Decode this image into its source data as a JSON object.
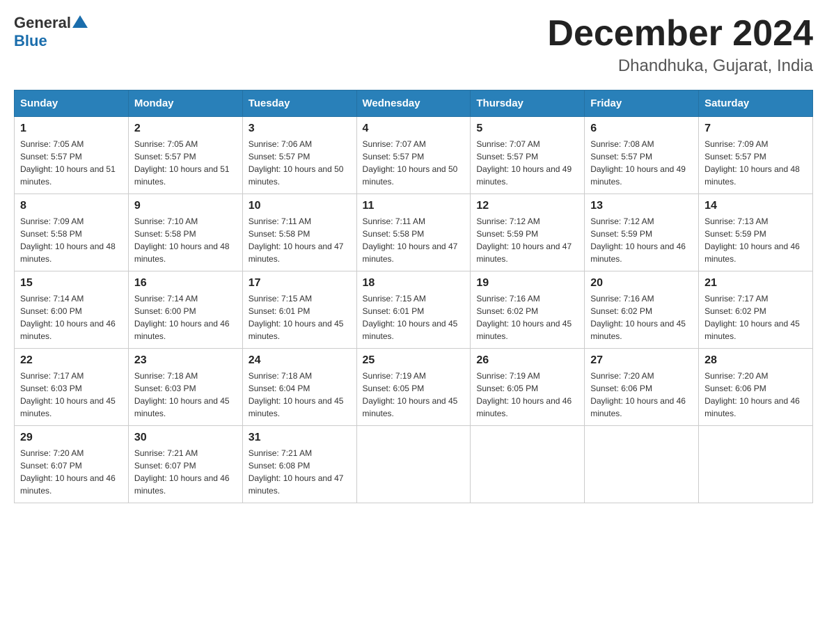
{
  "header": {
    "logo_general": "General",
    "logo_blue": "Blue",
    "month_title": "December 2024",
    "location": "Dhandhuka, Gujarat, India"
  },
  "weekdays": [
    "Sunday",
    "Monday",
    "Tuesday",
    "Wednesday",
    "Thursday",
    "Friday",
    "Saturday"
  ],
  "weeks": [
    [
      {
        "day": "1",
        "sunrise": "7:05 AM",
        "sunset": "5:57 PM",
        "daylight": "10 hours and 51 minutes."
      },
      {
        "day": "2",
        "sunrise": "7:05 AM",
        "sunset": "5:57 PM",
        "daylight": "10 hours and 51 minutes."
      },
      {
        "day": "3",
        "sunrise": "7:06 AM",
        "sunset": "5:57 PM",
        "daylight": "10 hours and 50 minutes."
      },
      {
        "day": "4",
        "sunrise": "7:07 AM",
        "sunset": "5:57 PM",
        "daylight": "10 hours and 50 minutes."
      },
      {
        "day": "5",
        "sunrise": "7:07 AM",
        "sunset": "5:57 PM",
        "daylight": "10 hours and 49 minutes."
      },
      {
        "day": "6",
        "sunrise": "7:08 AM",
        "sunset": "5:57 PM",
        "daylight": "10 hours and 49 minutes."
      },
      {
        "day": "7",
        "sunrise": "7:09 AM",
        "sunset": "5:57 PM",
        "daylight": "10 hours and 48 minutes."
      }
    ],
    [
      {
        "day": "8",
        "sunrise": "7:09 AM",
        "sunset": "5:58 PM",
        "daylight": "10 hours and 48 minutes."
      },
      {
        "day": "9",
        "sunrise": "7:10 AM",
        "sunset": "5:58 PM",
        "daylight": "10 hours and 48 minutes."
      },
      {
        "day": "10",
        "sunrise": "7:11 AM",
        "sunset": "5:58 PM",
        "daylight": "10 hours and 47 minutes."
      },
      {
        "day": "11",
        "sunrise": "7:11 AM",
        "sunset": "5:58 PM",
        "daylight": "10 hours and 47 minutes."
      },
      {
        "day": "12",
        "sunrise": "7:12 AM",
        "sunset": "5:59 PM",
        "daylight": "10 hours and 47 minutes."
      },
      {
        "day": "13",
        "sunrise": "7:12 AM",
        "sunset": "5:59 PM",
        "daylight": "10 hours and 46 minutes."
      },
      {
        "day": "14",
        "sunrise": "7:13 AM",
        "sunset": "5:59 PM",
        "daylight": "10 hours and 46 minutes."
      }
    ],
    [
      {
        "day": "15",
        "sunrise": "7:14 AM",
        "sunset": "6:00 PM",
        "daylight": "10 hours and 46 minutes."
      },
      {
        "day": "16",
        "sunrise": "7:14 AM",
        "sunset": "6:00 PM",
        "daylight": "10 hours and 46 minutes."
      },
      {
        "day": "17",
        "sunrise": "7:15 AM",
        "sunset": "6:01 PM",
        "daylight": "10 hours and 45 minutes."
      },
      {
        "day": "18",
        "sunrise": "7:15 AM",
        "sunset": "6:01 PM",
        "daylight": "10 hours and 45 minutes."
      },
      {
        "day": "19",
        "sunrise": "7:16 AM",
        "sunset": "6:02 PM",
        "daylight": "10 hours and 45 minutes."
      },
      {
        "day": "20",
        "sunrise": "7:16 AM",
        "sunset": "6:02 PM",
        "daylight": "10 hours and 45 minutes."
      },
      {
        "day": "21",
        "sunrise": "7:17 AM",
        "sunset": "6:02 PM",
        "daylight": "10 hours and 45 minutes."
      }
    ],
    [
      {
        "day": "22",
        "sunrise": "7:17 AM",
        "sunset": "6:03 PM",
        "daylight": "10 hours and 45 minutes."
      },
      {
        "day": "23",
        "sunrise": "7:18 AM",
        "sunset": "6:03 PM",
        "daylight": "10 hours and 45 minutes."
      },
      {
        "day": "24",
        "sunrise": "7:18 AM",
        "sunset": "6:04 PM",
        "daylight": "10 hours and 45 minutes."
      },
      {
        "day": "25",
        "sunrise": "7:19 AM",
        "sunset": "6:05 PM",
        "daylight": "10 hours and 45 minutes."
      },
      {
        "day": "26",
        "sunrise": "7:19 AM",
        "sunset": "6:05 PM",
        "daylight": "10 hours and 46 minutes."
      },
      {
        "day": "27",
        "sunrise": "7:20 AM",
        "sunset": "6:06 PM",
        "daylight": "10 hours and 46 minutes."
      },
      {
        "day": "28",
        "sunrise": "7:20 AM",
        "sunset": "6:06 PM",
        "daylight": "10 hours and 46 minutes."
      }
    ],
    [
      {
        "day": "29",
        "sunrise": "7:20 AM",
        "sunset": "6:07 PM",
        "daylight": "10 hours and 46 minutes."
      },
      {
        "day": "30",
        "sunrise": "7:21 AM",
        "sunset": "6:07 PM",
        "daylight": "10 hours and 46 minutes."
      },
      {
        "day": "31",
        "sunrise": "7:21 AM",
        "sunset": "6:08 PM",
        "daylight": "10 hours and 47 minutes."
      },
      null,
      null,
      null,
      null
    ]
  ]
}
